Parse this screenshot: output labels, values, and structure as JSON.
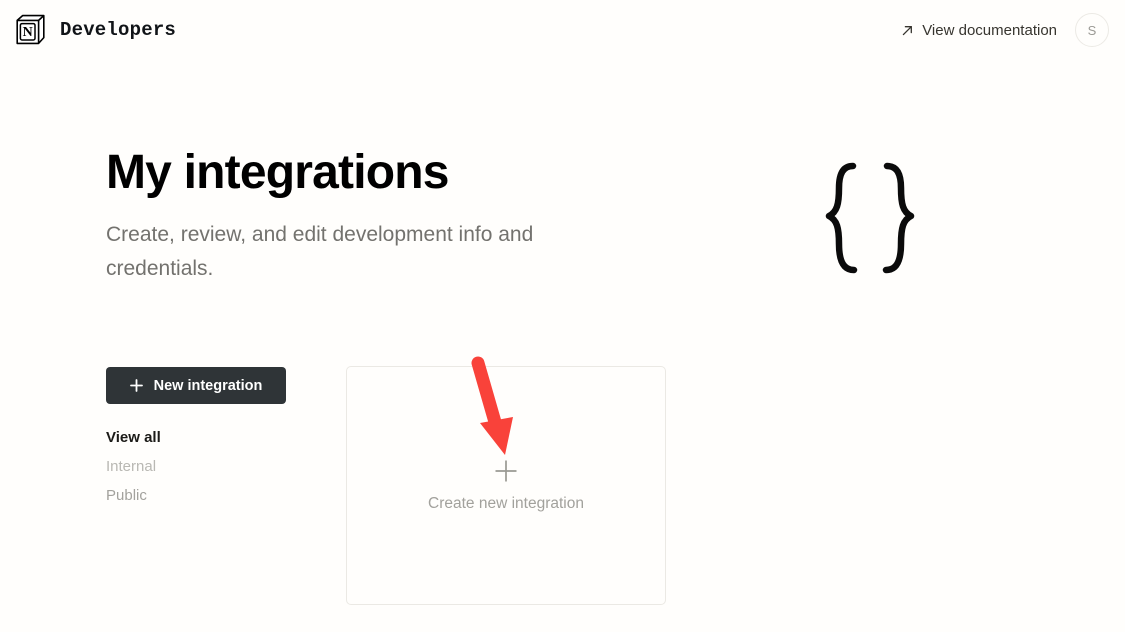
{
  "header": {
    "logo_icon": "notion-logo-icon",
    "brand_name": "Developers",
    "doc_link_label": "View documentation",
    "doc_link_icon": "arrow-up-right-icon",
    "avatar_initial": "S"
  },
  "main": {
    "title": "My integrations",
    "subtitle": "Create, review, and edit development info and credentials.",
    "illustration_icon": "curly-braces-icon",
    "new_integration_button": {
      "label": "New integration",
      "icon": "plus-icon"
    },
    "filters": [
      {
        "label": "View all",
        "active": true
      },
      {
        "label": "Internal",
        "active": false
      },
      {
        "label": "Public",
        "active": false
      }
    ],
    "create_card": {
      "label": "Create new integration",
      "icon": "plus-icon"
    },
    "annotation": {
      "icon": "red-arrow-icon",
      "color": "#f9423a"
    }
  },
  "colors": {
    "background": "#fffefc",
    "text_primary": "#000000",
    "text_muted": "#73726e",
    "button_dark": "#2f3437",
    "card_border": "#ebe9e4",
    "annotation_red": "#f9423a"
  }
}
